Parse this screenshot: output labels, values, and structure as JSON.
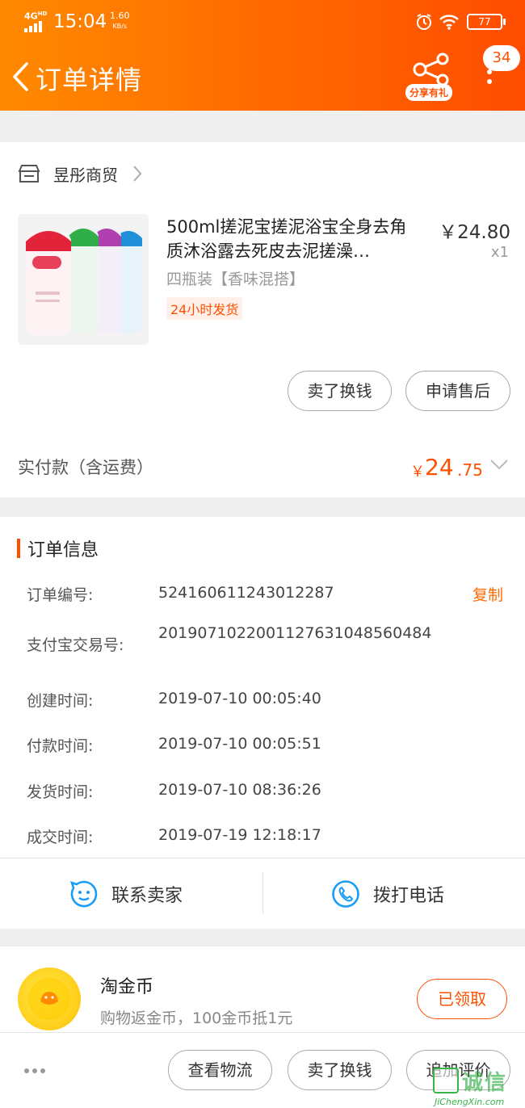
{
  "status_bar": {
    "network": "4G",
    "network_sub": "HD",
    "time": "15:04",
    "speed_value": "1.60",
    "speed_unit": "KB/s",
    "battery": "77"
  },
  "nav": {
    "title": "订单详情",
    "share_label": "分享有礼",
    "badge_count": "34"
  },
  "shop": {
    "name": "昱彤商贸"
  },
  "product": {
    "title": "500ml搓泥宝搓泥浴宝全身去角质沐浴露去死皮去泥搓澡…",
    "price": "￥24.80",
    "quantity": "x1",
    "sku": "四瓶装【香味混搭】",
    "tag": "24小时发货"
  },
  "item_actions": {
    "sell_label": "卖了换钱",
    "after_sale_label": "申请售后"
  },
  "payment": {
    "label": "实付款（含运费）",
    "currency": "￥",
    "amount_int": "24",
    "amount_dec": ".75"
  },
  "order_info": {
    "title": "订单信息",
    "copy_label": "复制",
    "rows": [
      {
        "label": "订单编号:",
        "value": "524160611243012287"
      },
      {
        "label": "支付宝交易号:",
        "value": "2019071022001127631048560484"
      },
      {
        "label": "创建时间:",
        "value": "2019-07-10 00:05:40"
      },
      {
        "label": "付款时间:",
        "value": "2019-07-10 00:05:51"
      },
      {
        "label": "发货时间:",
        "value": "2019-07-10 08:36:26"
      },
      {
        "label": "成交时间:",
        "value": "2019-07-19 12:18:17"
      }
    ]
  },
  "contact": {
    "seller_label": "联系卖家",
    "call_label": "拨打电话"
  },
  "coins": {
    "title": "淘金币",
    "subtitle": "购物返金币，100金币抵1元",
    "button_label": "已领取"
  },
  "bottom_bar": {
    "logistics_label": "查看物流",
    "sell_label": "卖了换钱",
    "review_label": "追加评价"
  },
  "watermark": {
    "text": "诚信",
    "url": "JiChengXin.com"
  },
  "colors": {
    "accent": "#ff5000",
    "header_start": "#ff8a00",
    "header_end": "#ff4d00",
    "link_blue": "#1a9df5"
  }
}
